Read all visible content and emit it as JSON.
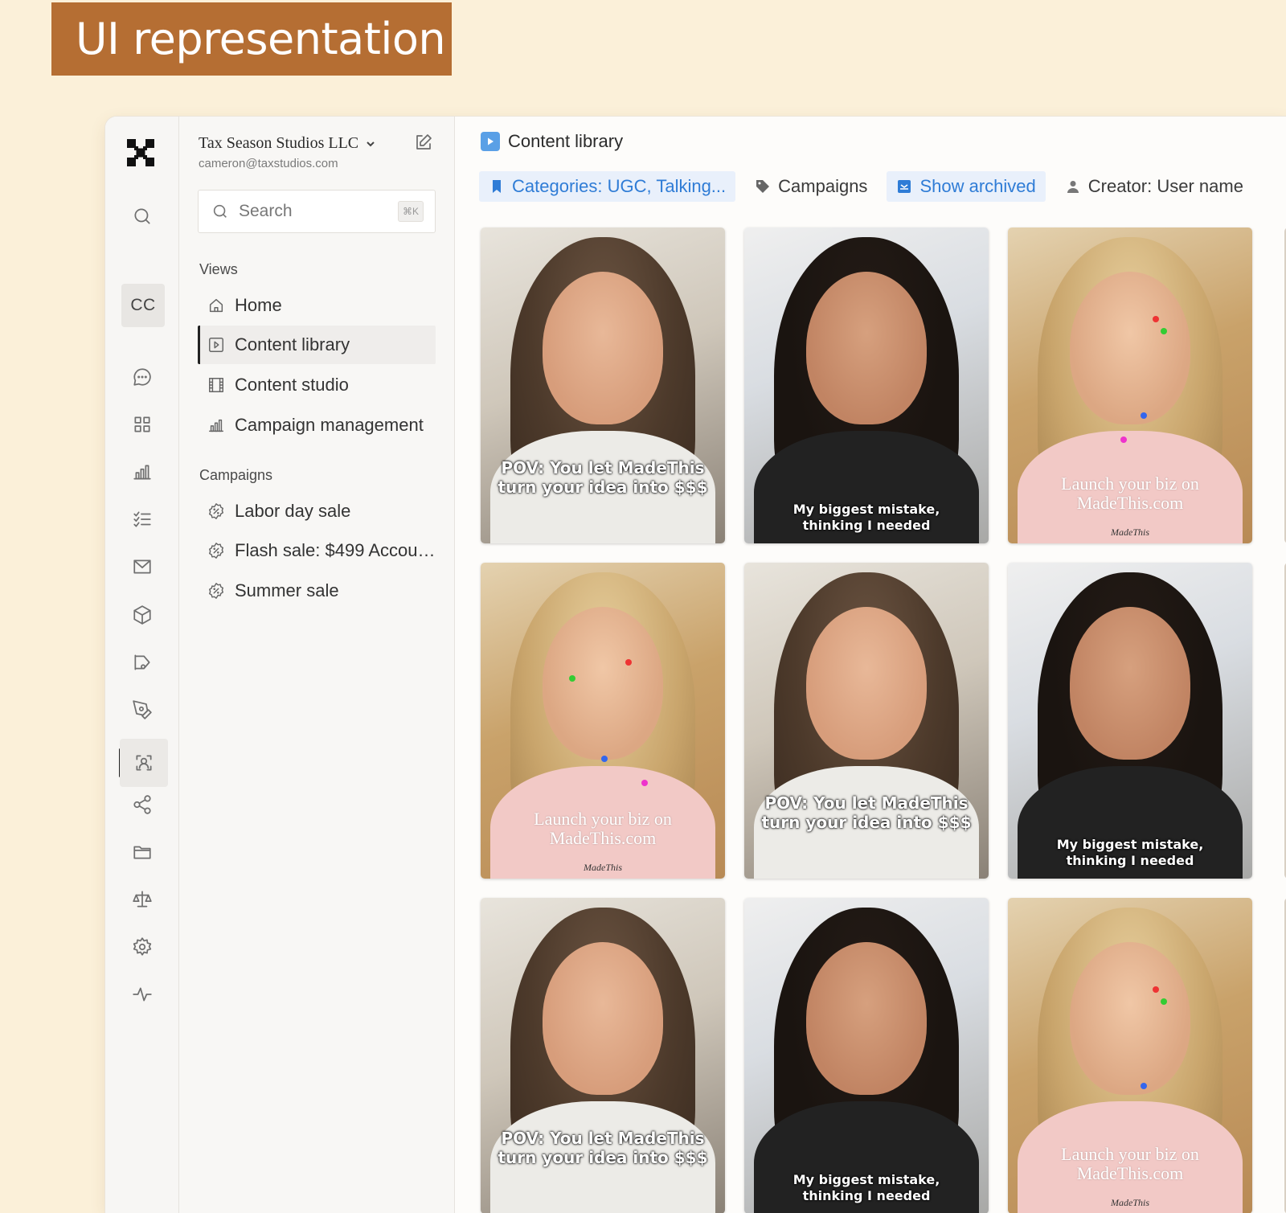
{
  "banner": {
    "title": "UI representation"
  },
  "org": {
    "name": "Tax Season Studios LLC",
    "email": "cameron@taxstudios.com"
  },
  "rail": {
    "avatar_initials": "CC"
  },
  "search": {
    "placeholder": "Search",
    "shortcut": "⌘K"
  },
  "views": {
    "label": "Views",
    "items": [
      {
        "label": "Home",
        "icon": "home-icon"
      },
      {
        "label": "Content library",
        "icon": "play-square-icon",
        "active": true
      },
      {
        "label": "Content studio",
        "icon": "film-icon"
      },
      {
        "label": "Campaign management",
        "icon": "bar-chart-icon"
      }
    ]
  },
  "campaigns": {
    "label": "Campaigns",
    "items": [
      {
        "label": "Labor day sale",
        "icon": "discount-badge-icon"
      },
      {
        "label": "Flash sale: $499 Accoun...",
        "icon": "discount-badge-icon"
      },
      {
        "label": "Summer sale",
        "icon": "discount-badge-icon"
      }
    ]
  },
  "main": {
    "title": "Content library",
    "filters": [
      {
        "label": "Categories: UGC, Talking...",
        "icon": "bookmark-icon",
        "active": true
      },
      {
        "label": "Campaigns",
        "icon": "tag-icon",
        "active": false
      },
      {
        "label": "Show archived",
        "icon": "archive-icon",
        "active": true
      },
      {
        "label": "Creator: User name",
        "icon": "user-icon",
        "active": false
      }
    ]
  },
  "captions": {
    "pov": [
      "POV: You let MadeThis",
      "turn your idea into $$$"
    ],
    "mistake": [
      "My biggest mistake,",
      "thinking I needed"
    ],
    "launch": [
      "Launch your biz on",
      "MadeThis.com"
    ],
    "watermark": "MadeThis"
  },
  "colors": {
    "accent_blue": "#2f7cd6",
    "banner": "#b56e33",
    "background": "#fbf0d9"
  }
}
